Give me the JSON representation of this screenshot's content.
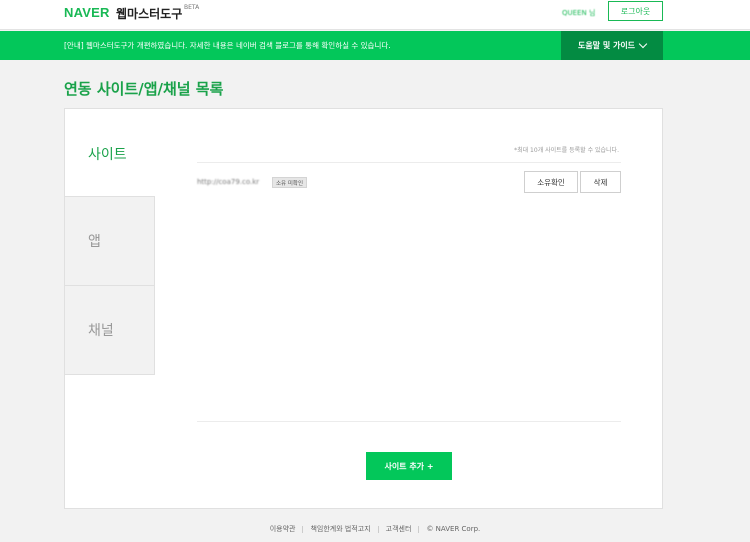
{
  "header": {
    "brand": "NAVER",
    "product": "웹마스터도구",
    "beta": "BETA",
    "user_name": "QUEEN 님",
    "logout_label": "로그아웃"
  },
  "notice": {
    "text": "[안내] 웹마스터도구가 개편하였습니다. 자세한 내용은 네이버 검색 블로그를 통해 확인하실 수 있습니다.",
    "help_label": "도움말 및 가이드"
  },
  "page_title": "연동 사이트/앱/채널 목록",
  "tabs": [
    {
      "label": "사이트",
      "active": true
    },
    {
      "label": "앱",
      "active": false
    },
    {
      "label": "채널",
      "active": false
    }
  ],
  "site_list": {
    "limit_note": "*최대 10개 사이트를 등록할 수 있습니다.",
    "items": [
      {
        "url": "http://coa79.co.kr",
        "status_badge": "소유 미확인",
        "verify_label": "소유확인",
        "delete_label": "삭제"
      }
    ],
    "add_label": "사이트 추가 +"
  },
  "footer": {
    "links": [
      "이용약관",
      "책임한계와 법적고지",
      "고객센터"
    ],
    "copyright": "© NAVER Corp."
  },
  "colors": {
    "brand_green": "#03c75a",
    "dark_green": "#038b42",
    "title_green": "#1aa24a"
  }
}
